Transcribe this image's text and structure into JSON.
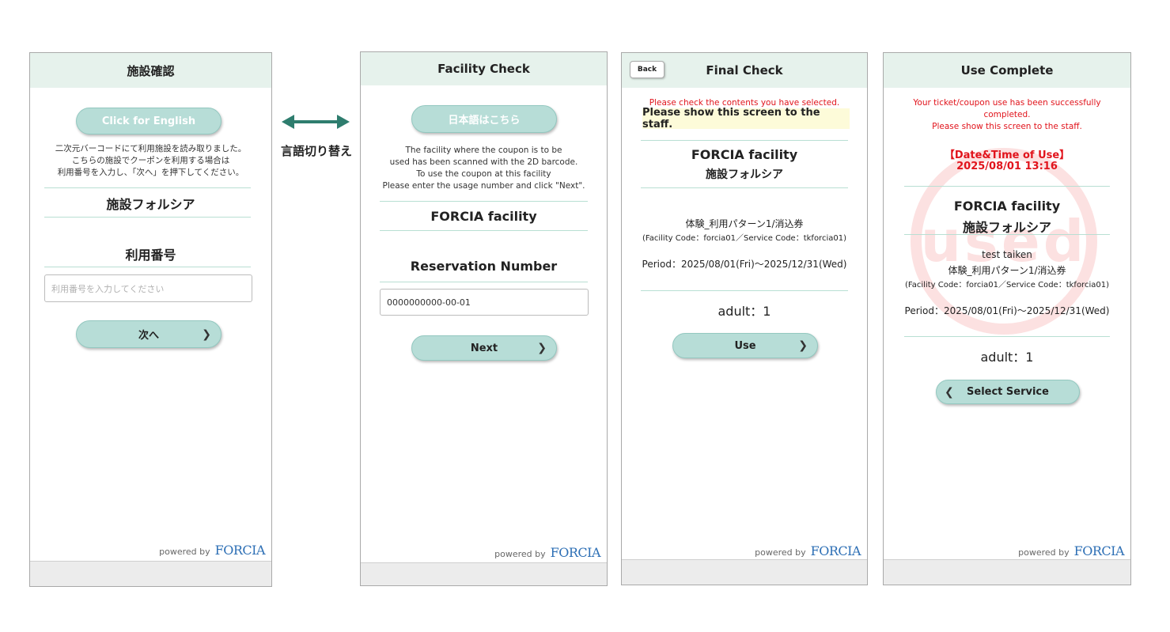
{
  "screen1": {
    "header": "施設確認",
    "lang_button": "Click for English",
    "instructions": [
      "二次元バーコードにて利用施設を読み取りました。",
      "こちらの施設でクーポンを利用する場合は",
      "利用番号を入力し、「次へ」を押下してください。"
    ],
    "facility_name": "施設フォルシア",
    "number_label": "利用番号",
    "input_placeholder": "利用番号を入力してください",
    "next_button": "次へ",
    "powered_by": "powered by",
    "brand": "FORCIA"
  },
  "switch_label": "言語切り替え",
  "screen2": {
    "header": "Facility Check",
    "lang_button": "日本語はこちら",
    "instructions": [
      "The facility where the coupon is to be",
      "used has been scanned with the 2D barcode.",
      "To use the coupon at this facility",
      "Please enter the usage number and click \"Next\"."
    ],
    "facility_name": "FORCIA facility",
    "number_label": "Reservation Number",
    "input_value": "0000000000-00-01",
    "next_button": "Next",
    "powered_by": "powered by",
    "brand": "FORCIA"
  },
  "screen3": {
    "header": "Final Check",
    "back_button": "Back",
    "notice": "Please check the contents you have selected.",
    "show_staff": "Please show this screen to the staff.",
    "facility_en": "FORCIA facility",
    "facility_ja": "施設フォルシア",
    "service_name": "体験_利用パターン1/消込券",
    "codes": "(Facility Code：forcia01／Service Code：tkforcia01)",
    "period": "Period：2025/08/01(Fri)～2025/12/31(Wed)",
    "quantity": "adult：1",
    "use_button": "Use",
    "powered_by": "powered by",
    "brand": "FORCIA"
  },
  "screen4": {
    "header": "Use Complete",
    "notice_lines": [
      "Your ticket/coupon use has been successfully",
      "completed.",
      "Please show this screen to the staff."
    ],
    "date_label": "【Date&Time of Use】",
    "date_value": "2025/08/01 13:16",
    "stamp_text": "used",
    "facility_en": "FORCIA facility",
    "facility_ja": "施設フォルシア",
    "customer": "test taiken",
    "service_name": "体験_利用パターン1/消込券",
    "codes": "(Facility Code：forcia01／Service Code：tkforcia01)",
    "period": "Period：2025/08/01(Fri)～2025/12/31(Wed)",
    "quantity": "adult：1",
    "select_button": "Select Service",
    "powered_by": "powered by",
    "brand": "FORCIA"
  },
  "colors": {
    "header_bg": "#e6f2ec",
    "button_bg": "#b7ddd7",
    "accent_arrow": "#2e7d6e",
    "notice_red": "#e1141c",
    "brand_blue": "#2d6fb5"
  },
  "icons": {
    "arrow": "double-arrow-icon",
    "chevron_right": "chevron-right-icon",
    "chevron_left": "chevron-left-icon"
  }
}
